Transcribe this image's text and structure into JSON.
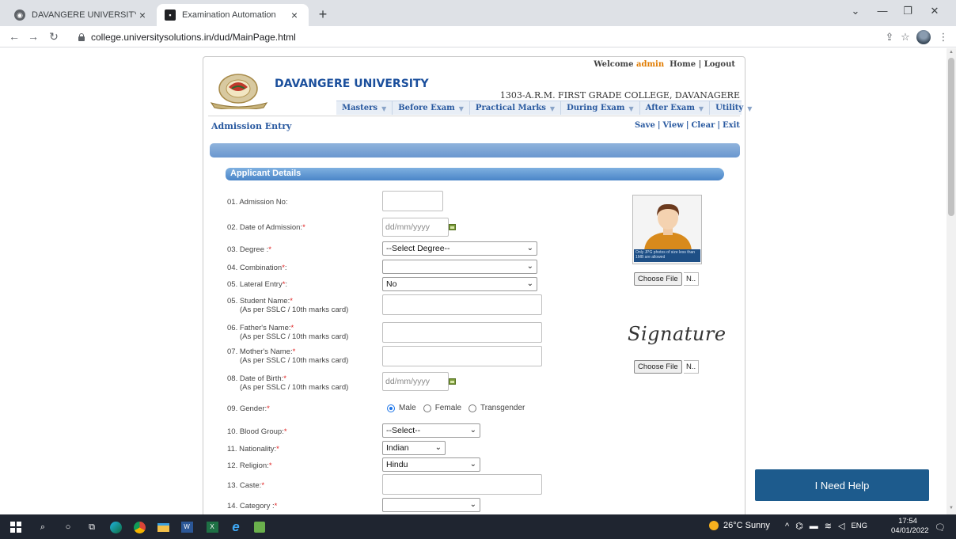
{
  "browser": {
    "tabs": [
      {
        "title": "DAVANGERE UNIVERSITY",
        "active": false
      },
      {
        "title": "Examination Automation",
        "active": true
      }
    ],
    "url": "college.universitysolutions.in/dud/MainPage.html"
  },
  "header": {
    "welcome_prefix": "Welcome",
    "username": "admin",
    "home_link": "Home",
    "logout_link": "Logout",
    "university": "DAVANGERE UNIVERSITY",
    "college": "1303-A.R.M. FIRST GRADE COLLEGE, DAVANAGERE"
  },
  "menu": [
    "Masters",
    "Before Exam",
    "Practical Marks",
    "During Exam",
    "After Exam",
    "Utility"
  ],
  "page": {
    "heading": "Admission Entry",
    "actions": [
      "Save",
      "View",
      "Clear",
      "Exit"
    ],
    "section_title": "Applicant Details"
  },
  "form": {
    "admission_no": {
      "label": "01. Admission No:",
      "value": ""
    },
    "date_of_admission": {
      "label": "02. Date of Admission:",
      "placeholder": "dd/mm/yyyy"
    },
    "degree": {
      "label": "03. Degree :",
      "value": "--Select Degree--"
    },
    "combination": {
      "label": "04. Combination",
      "value": ""
    },
    "lateral_entry": {
      "label": "05. Lateral Entry",
      "value": "No"
    },
    "student_name": {
      "label": "05. Student Name:",
      "sub": "(As per SSLC / 10th marks card)"
    },
    "father_name": {
      "label": "06. Father's Name:",
      "sub": "(As per SSLC / 10th marks card)"
    },
    "mother_name": {
      "label": "07. Mother's Name:",
      "sub": "(As per SSLC / 10th marks card)"
    },
    "dob": {
      "label": "08. Date of Birth:",
      "sub": "(As per SSLC / 10th marks card)",
      "placeholder": "dd/mm/yyyy"
    },
    "gender": {
      "label": "09. Gender:",
      "options": [
        "Male",
        "Female",
        "Transgender"
      ],
      "selected": "Male"
    },
    "blood_group": {
      "label": "10. Blood Group:",
      "value": "--Select--"
    },
    "nationality": {
      "label": "11. Nationality:",
      "value": "Indian"
    },
    "religion": {
      "label": "12. Religion:",
      "value": "Hindu"
    },
    "caste": {
      "label": "13. Caste:",
      "value": ""
    },
    "category": {
      "label": "14. Category :",
      "value": ""
    }
  },
  "uploads": {
    "photo_caption": "Only JPG photos of size less than 1MB are allowed",
    "choose_file": "Choose File",
    "file_status": "N..",
    "signature_text": "Signature"
  },
  "help": {
    "label": "I Need Help"
  },
  "taskbar": {
    "weather": "26°C  Sunny",
    "lang": "ENG",
    "time": "17:54",
    "date": "04/01/2022"
  }
}
